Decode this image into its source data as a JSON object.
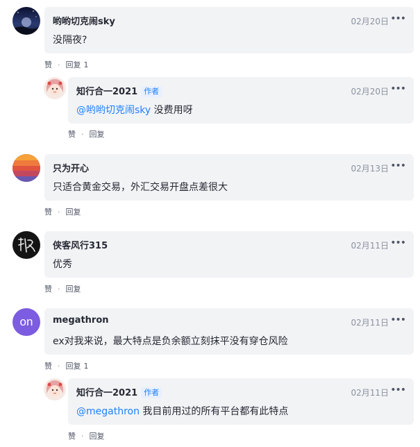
{
  "comments": [
    {
      "username": "哟哟切克闹sky",
      "date": "02月20日",
      "text": "没隔夜?",
      "like_label": "赞",
      "reply_label": "回复",
      "reply_count": "1",
      "avatar_icon": "night-sky-avatar",
      "replies": [
        {
          "username": "知行合一2021",
          "author_tag": "作者",
          "date": "02月20日",
          "mention": "@哟哟切克闹sky",
          "text": " 没费用呀",
          "like_label": "赞",
          "reply_label": "回复",
          "avatar_icon": "doll-avatar"
        }
      ]
    },
    {
      "username": "只为开心",
      "date": "02月13日",
      "text": "只适合黄金交易，外汇交易开盘点差很大",
      "like_label": "赞",
      "reply_label": "回复",
      "avatar_icon": "sunset-avatar"
    },
    {
      "username": "侠客风行315",
      "date": "02月11日",
      "text": "优秀",
      "like_label": "赞",
      "reply_label": "回复",
      "avatar_icon": "calligraphy-avatar"
    },
    {
      "username": "megathron",
      "date": "02月11日",
      "text": "ex对我来说，最大特点是负余额立刻抹平没有穿仓风险",
      "like_label": "赞",
      "reply_label": "回复",
      "reply_count": "1",
      "avatar_icon": "initials-avatar",
      "avatar_text": "on",
      "replies": [
        {
          "username": "知行合一2021",
          "author_tag": "作者",
          "date": "02月11日",
          "mention": "@megathron",
          "text": " 我目前用过的所有平台都有此特点",
          "like_label": "赞",
          "reply_label": "回复",
          "avatar_icon": "doll-avatar"
        }
      ]
    }
  ],
  "more_icon": "more-dots-icon",
  "colors": {
    "bubble_bg": "#f2f3f5",
    "mention": "#1e80ff",
    "avatar_purple": "#7c5ce0"
  }
}
